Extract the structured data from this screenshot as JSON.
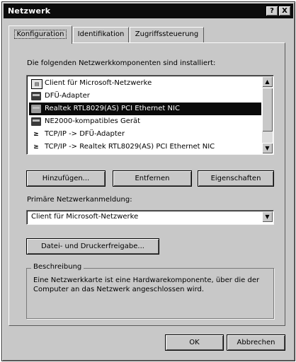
{
  "window": {
    "title": "Netzwerk",
    "help_button": "?",
    "close_button": "X"
  },
  "tabs": [
    "Konfiguration",
    "Identifikation",
    "Zugriffssteuerung"
  ],
  "components": {
    "intro": "Die folgenden Netzwerkkomponenten sind installiert:",
    "items": [
      {
        "label": "Client für Microsoft-Netzwerke",
        "icon": "client-icon",
        "selected": false
      },
      {
        "label": "DFÜ-Adapter",
        "icon": "network-card-icon",
        "selected": false
      },
      {
        "label": "Realtek RTL8029(AS) PCI Ethernet NIC",
        "icon": "network-card-icon",
        "selected": true
      },
      {
        "label": "NE2000-kompatibles Gerät",
        "icon": "network-card-icon",
        "selected": false
      },
      {
        "label": "TCP/IP -> DFÜ-Adapter",
        "icon": "protocol-icon",
        "selected": false
      },
      {
        "label": "TCP/IP -> Realtek RTL8029(AS) PCI Ethernet NIC",
        "icon": "protocol-icon",
        "selected": false
      }
    ]
  },
  "actions": {
    "add": "Hinzufügen...",
    "remove": "Entfernen",
    "properties": "Eigenschaften"
  },
  "logon": {
    "label": "Primäre Netzwerkanmeldung:",
    "value": "Client für Microsoft-Netzwerke"
  },
  "sharing_button": "Datei- und Druckerfreigabe...",
  "description": {
    "legend": "Beschreibung",
    "text": "Eine Netzwerkkarte ist eine Hardwarekomponente, über die der Computer an das Netzwerk angeschlossen wird."
  },
  "footer": {
    "ok": "OK",
    "cancel": "Abbrechen"
  },
  "colors": {
    "dialog_bg": "#c8c8c8",
    "title_bar": "#0c0c0c",
    "selection": "#0a0a0a"
  }
}
